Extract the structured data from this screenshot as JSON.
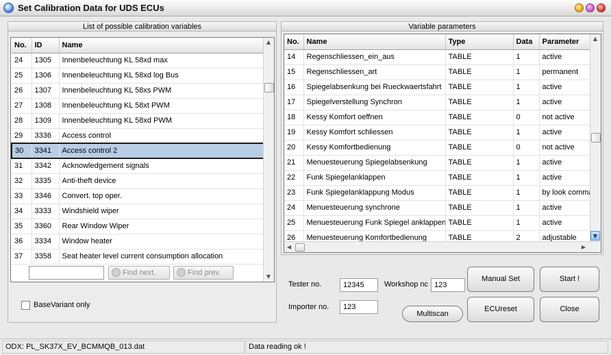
{
  "window": {
    "title": "Set Calibration Data for UDS ECUs"
  },
  "left_panel": {
    "title": "List of possible calibration variables",
    "columns": [
      "No.",
      "ID",
      "Name"
    ],
    "rows": [
      [
        "24",
        "1305",
        "Innenbeleuchtung KL 58xd max"
      ],
      [
        "25",
        "1306",
        "Innenbeleuchtung KL 58xd log Bus"
      ],
      [
        "26",
        "1307",
        "Innenbeleuchtung KL 58xs PWM"
      ],
      [
        "27",
        "1308",
        "Innenbeleuchtung KL 58xt PWM"
      ],
      [
        "28",
        "1309",
        "Innenbeleuchtung KL 58xd PWM"
      ],
      [
        "29",
        "3336",
        "Access control"
      ],
      [
        "30",
        "3341",
        "Access control 2"
      ],
      [
        "31",
        "3342",
        "Acknowledgement signals"
      ],
      [
        "32",
        "3335",
        "Anti-theft device"
      ],
      [
        "33",
        "3346",
        "Convert. top oper."
      ],
      [
        "34",
        "3333",
        "Windshield wiper"
      ],
      [
        "35",
        "3360",
        "Rear Window Wiper"
      ],
      [
        "36",
        "3334",
        "Window heater"
      ],
      [
        "37",
        "3358",
        "Seat heater level current consumption allocation"
      ]
    ],
    "selected_no": "30",
    "search": {
      "value": "",
      "find_next": "Find next.",
      "find_prev": "Find prev."
    },
    "base_variant_label": "BaseVariant only"
  },
  "right_panel": {
    "title": "Variable parameters",
    "columns": [
      "No.",
      "Name",
      "Type",
      "Data",
      "Parameter"
    ],
    "rows": [
      [
        "14",
        "Regenschliessen_ein_aus",
        "TABLE",
        "1",
        "active"
      ],
      [
        "15",
        "Regenschliessen_art",
        "TABLE",
        "1",
        "permanent"
      ],
      [
        "16",
        "Spiegelabsenkung bei Rueckwaertsfahrt",
        "TABLE",
        "1",
        "active"
      ],
      [
        "17",
        "Spiegelverstellung Synchron",
        "TABLE",
        "1",
        "active"
      ],
      [
        "18",
        "Kessy Komfort oeffnen",
        "TABLE",
        "0",
        "not active"
      ],
      [
        "19",
        "Kessy Komfort schliessen",
        "TABLE",
        "1",
        "active"
      ],
      [
        "20",
        "Kessy Komfortbedienung",
        "TABLE",
        "0",
        "not active"
      ],
      [
        "21",
        "Menuesteuerung Spiegelabsenkung",
        "TABLE",
        "1",
        "active"
      ],
      [
        "22",
        "Funk Spiegelanklappen",
        "TABLE",
        "1",
        "active"
      ],
      [
        "23",
        "Funk Spiegelanklappung Modus",
        "TABLE",
        "1",
        "by look comma"
      ],
      [
        "24",
        "Menuesteuerung synchrone",
        "TABLE",
        "1",
        "active"
      ],
      [
        "25",
        "Menuesteuerung Funk Spiegel anklappen",
        "TABLE",
        "1",
        "active"
      ],
      [
        "26",
        "Menuesteuerung Komfortbedienung",
        "TABLE",
        "2",
        "adjustable"
      ]
    ]
  },
  "fields": {
    "tester_label": "Tester no.",
    "tester_value": "12345",
    "workshop_label": "Workshop nc",
    "workshop_value": "123",
    "importer_label": "Importer no.",
    "importer_value": "123"
  },
  "buttons": {
    "manual_set": "Manual Set",
    "start": "Start !",
    "ecureset": "ECUreset",
    "close": "Close",
    "multiscan": "Multiscan"
  },
  "status": {
    "odx": "ODX: PL_SK37X_EV_BCMMQB_013.dat",
    "message": "Data reading ok !"
  }
}
